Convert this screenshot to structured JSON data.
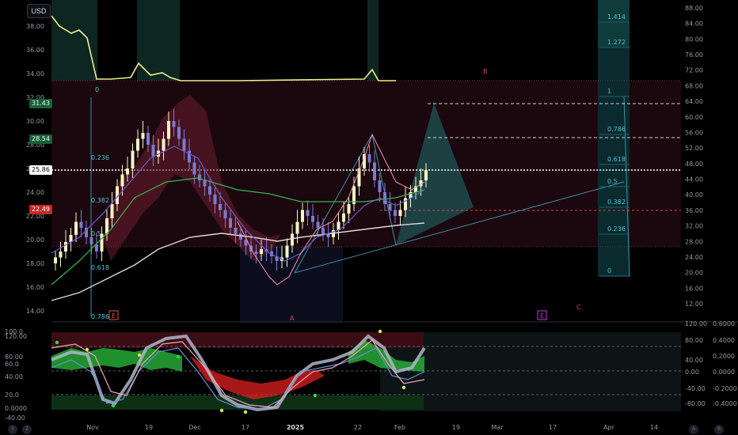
{
  "currency": "USD",
  "colors": {
    "background": "#000000",
    "bull": "#f5f5c8",
    "bear": "#7a7bd0",
    "overlay_red": "#4a0f1e",
    "teal_zone": "#1f6f6f",
    "fib_text": "#4fc3d8",
    "price_line": "#ffffff",
    "red_line": "#e0404a",
    "green_osc": "#2ecc40",
    "red_osc": "#e02020"
  },
  "left_axis_labels": [
    "38.00",
    "36.00",
    "34.00",
    "32.00",
    "30.00",
    "28.00",
    "26.00",
    "24.00",
    "22.00",
    "20.00",
    "18.00",
    "16.00",
    "14.00"
  ],
  "left_axis_values": [
    38,
    36,
    34,
    32,
    30,
    28,
    26,
    24,
    22,
    20,
    18,
    16,
    14
  ],
  "right_axis_labels": [
    "88.00",
    "84.00",
    "80.00",
    "76.00",
    "72.00",
    "68.00",
    "64.00",
    "60.00",
    "56.00",
    "52.00",
    "48.00",
    "44.00",
    "40.00",
    "36.00",
    "32.00",
    "28.00",
    "24.00",
    "20.00",
    "16.00",
    "12.00"
  ],
  "right_axis_values": [
    88,
    84,
    80,
    76,
    72,
    68,
    64,
    60,
    56,
    52,
    48,
    44,
    40,
    36,
    32,
    28,
    24,
    20,
    16,
    12
  ],
  "price_badges": {
    "level_1": "31.43",
    "level_2": "28.54",
    "current": "25.86",
    "stop": "22.49"
  },
  "fib_left": [
    "0",
    "0.236",
    "0.382",
    "0.5",
    "0.618",
    "0.786"
  ],
  "fib_right": [
    "1.414",
    "1.272",
    "1",
    "0.786",
    "0.618",
    "0.5",
    "0.382",
    "0.236",
    "0"
  ],
  "wave_labels": {
    "a": "A",
    "b": "B",
    "c": "C"
  },
  "event_markers": [
    "E",
    "E"
  ],
  "osc_left_labels": [
    "100.0",
    "120.00",
    "80.00",
    "60.0",
    "40.00",
    "20.0",
    "0.0000",
    "-40.00"
  ],
  "osc_left_values": [
    100,
    120,
    80,
    60,
    40,
    20,
    0,
    -40
  ],
  "osc_right_inner_labels": [
    "120.00",
    "80.00",
    "40.00",
    "0.00",
    "-40.00",
    "-80.00"
  ],
  "osc_right_inner_values": [
    120,
    80,
    40,
    0,
    -40,
    -80
  ],
  "osc_right_outer_labels": [
    "0.6000",
    "0.4000",
    "0.2000",
    "0.0000",
    "-0.2000",
    "-0.4000"
  ],
  "osc_right_outer_values": [
    0.6,
    0.4,
    0.2,
    0,
    -0.2,
    -0.4
  ],
  "time_labels": [
    "Nov",
    "19",
    "Dec",
    "17",
    "2025",
    "22",
    "Feb",
    "19",
    "Mar",
    "17",
    "Apr",
    "14"
  ],
  "corner_glyphs": [
    "Y",
    "Z",
    "A",
    "B"
  ]
}
